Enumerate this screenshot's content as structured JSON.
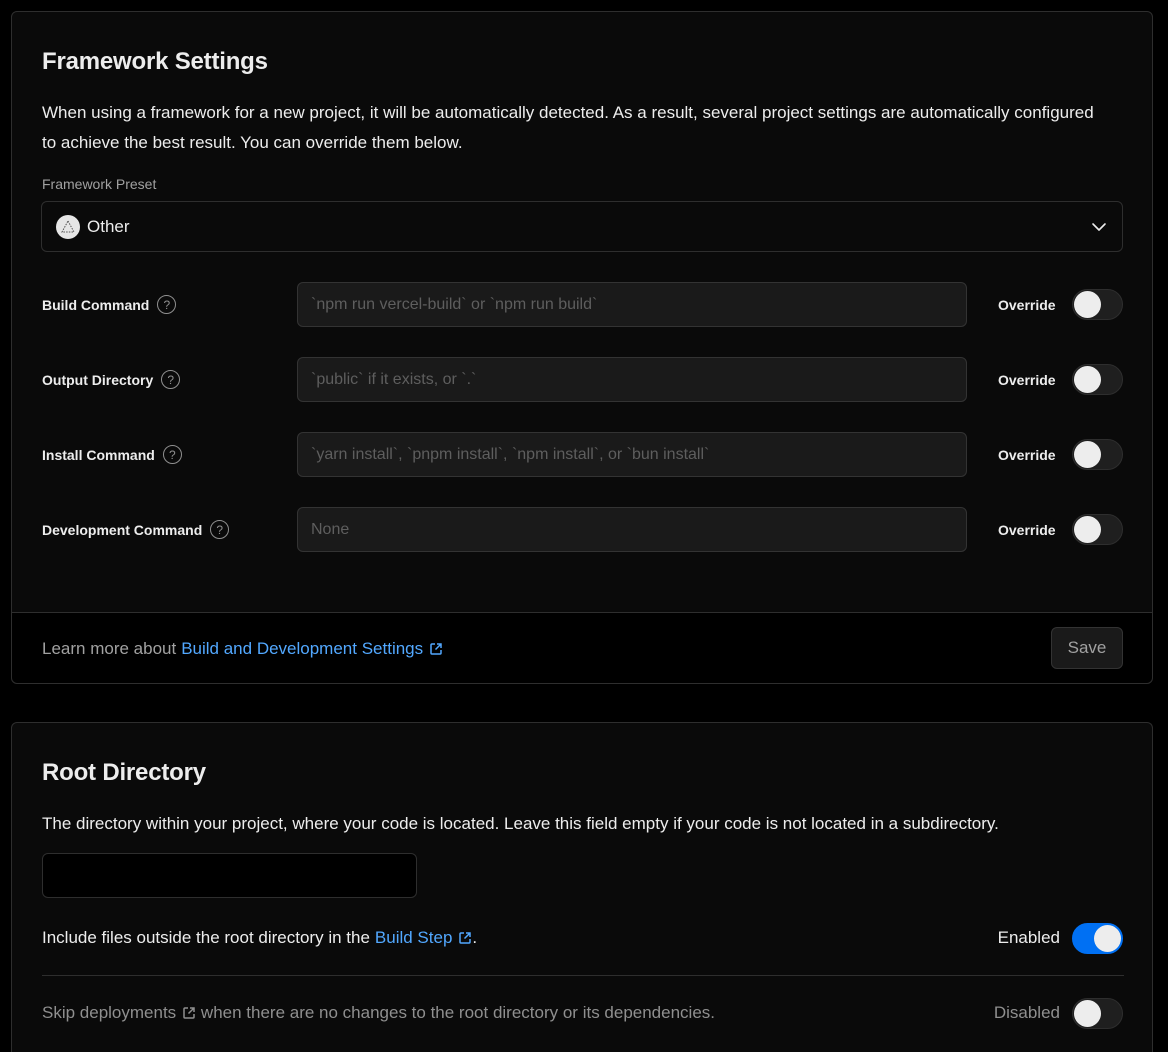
{
  "framework": {
    "title": "Framework Settings",
    "description": "When using a framework for a new project, it will be automatically detected. As a result, several project settings are automatically configured to achieve the best result. You can override them below.",
    "preset_label": "Framework Preset",
    "preset_value": "Other",
    "preset_icon": "triangle-logo-icon",
    "override_label": "Override",
    "rows": [
      {
        "label": "Build Command",
        "placeholder": "`npm run vercel-build` or `npm run build`",
        "override": false
      },
      {
        "label": "Output Directory",
        "placeholder": "`public` if it exists, or `.`",
        "override": false
      },
      {
        "label": "Install Command",
        "placeholder": "`yarn install`, `pnpm install`, `npm install`, or `bun install`",
        "override": false
      },
      {
        "label": "Development Command",
        "placeholder": "None",
        "override": false
      }
    ],
    "footer": {
      "text": "Learn more about",
      "link": "Build and Development Settings",
      "save_label": "Save"
    }
  },
  "root_directory": {
    "title": "Root Directory",
    "description": "The directory within your project, where your code is located. Leave this field empty if your code is not located in a subdirectory.",
    "value": "",
    "include_files": {
      "text_before": "Include files outside the root directory in the",
      "link": "Build Step",
      "text_after": ".",
      "state": "Enabled",
      "enabled": true
    },
    "skip_deployments": {
      "link": "Skip deployments",
      "text_after": " when there are no changes to the root directory or its dependencies.",
      "state": "Disabled",
      "enabled": false
    }
  },
  "colors": {
    "accent": "#0070f3",
    "link": "#52a8ff",
    "background": "#000000",
    "card": "#0a0a0a",
    "border": "#2e2e2e"
  }
}
